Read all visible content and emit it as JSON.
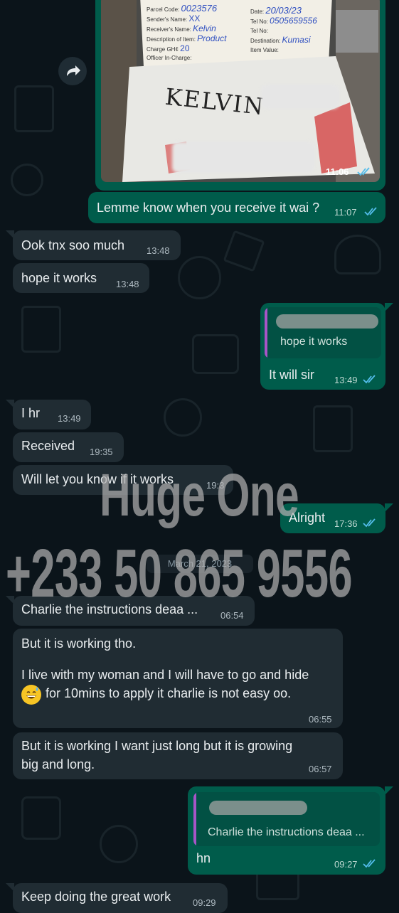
{
  "watermark": {
    "line1": "Huge One",
    "line2": "+233 50 865 9556"
  },
  "image_message": {
    "time": "11:07",
    "photo_time": "11:06",
    "caption": "Lemme know when you receive it wai ?",
    "form": {
      "parcel_code_label": "Parcel Code:",
      "parcel_code_value": "0023576",
      "sender_label": "Sender's Name:",
      "sender_value": "XX",
      "date_label": "Date:",
      "date_value": "20/03/23",
      "tel_label": "Tel No:",
      "tel_value": "0505659556",
      "receiver_label": "Receiver's Name:",
      "receiver_value": "Kelvin",
      "tel2_label": "Tel No:",
      "description_label": "Description of Item:",
      "description_value": "Product",
      "destination_label": "Destination:",
      "destination_value": "Kumasi",
      "charge_label": "Charge GH¢",
      "charge_value": "20",
      "officer_label": "Officer In-Charge:",
      "item_value_label": "Item Value:",
      "package_name": "KELVIN"
    }
  },
  "messages": [
    {
      "dir": "in",
      "text": "Ook tnx soo much",
      "time": "13:48"
    },
    {
      "dir": "in",
      "text": "hope it works",
      "time": "13:48"
    },
    {
      "dir": "out",
      "quote": "hope it works",
      "text": "It will sir",
      "time": "13:49"
    },
    {
      "dir": "in",
      "text": "I hr",
      "time": "13:49"
    },
    {
      "dir": "in",
      "text": "Received",
      "time": "19:35"
    },
    {
      "dir": "in",
      "text": "Will let you know if it works",
      "time": "19:3"
    },
    {
      "dir": "out",
      "text": "Alright",
      "time": "17:36"
    },
    {
      "dir": "in",
      "text": "Charlie the instructions deaa ...",
      "time": "06:54"
    },
    {
      "dir": "in",
      "text1": "But it is working tho.",
      "text2": "I live with my woman and I will have to go and hide",
      "text3": "for 10mins to apply it charlie is not easy oo.",
      "time": "06:55"
    },
    {
      "dir": "in",
      "text1": "But it is working I want just long  but it is growing",
      "text2": "big and long.",
      "time": "06:57"
    },
    {
      "dir": "out",
      "quote": "Charlie the instructions deaa ...",
      "text": "hn",
      "time": "09:27"
    },
    {
      "dir": "in",
      "text": "Keep doing the great work",
      "time": "09:29"
    }
  ],
  "date_separator": "March 21, 2023",
  "icons": {
    "forward": "forward-icon",
    "read_receipt": "double-check-icon",
    "emoji": "grinning-sweat-emoji"
  },
  "colors": {
    "background": "#0b141a",
    "incoming": "#202c33",
    "outgoing": "#005c4b",
    "ticks": "#53bdeb",
    "quote_bar": "#a855c7"
  }
}
